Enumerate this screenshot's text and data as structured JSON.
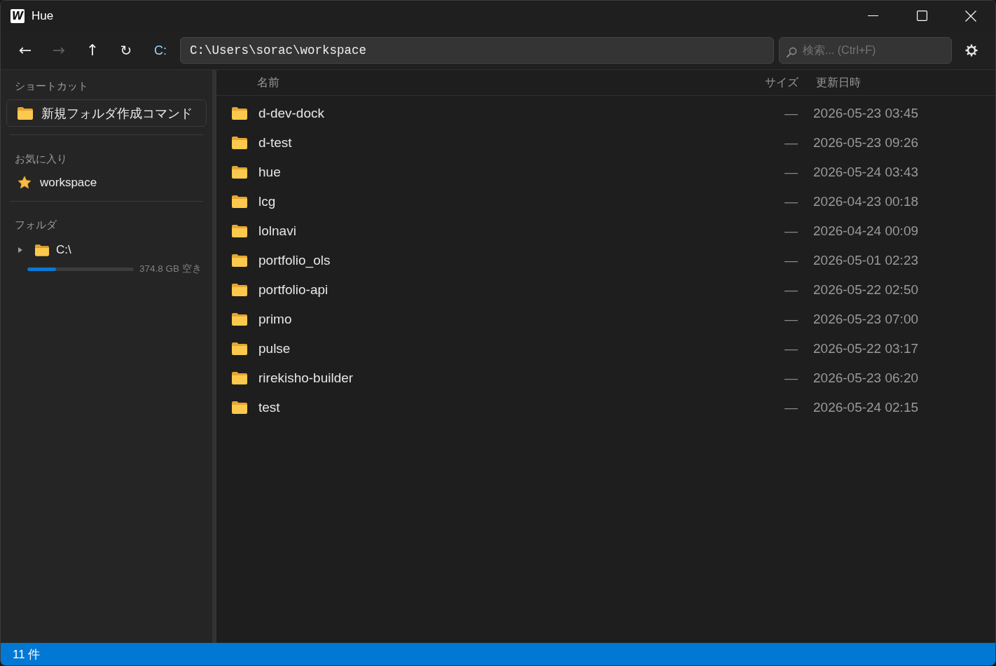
{
  "window": {
    "app_icon": "W",
    "title": "Hue"
  },
  "toolbar": {
    "nav_buttons": [
      {
        "kind": "back",
        "label": "←",
        "disabled": false
      },
      {
        "kind": "forward",
        "label": "→",
        "disabled": true
      },
      {
        "kind": "up",
        "label": "↑",
        "disabled": false
      },
      {
        "kind": "refresh",
        "label": "↻",
        "disabled": false
      },
      {
        "kind": "drive",
        "label": "C:",
        "disabled": false
      }
    ],
    "path": "C:\\Users\\sorac\\workspace",
    "search": {
      "placeholder": "検索... (Ctrl+F)"
    }
  },
  "sidebar": {
    "shortcuts": {
      "title": "ショートカット",
      "items": [
        {
          "label": "新規フォルダ作成コマンド"
        }
      ]
    },
    "favorites": {
      "title": "お気に入り",
      "items": [
        {
          "label": "workspace"
        }
      ]
    },
    "folders": {
      "title": "フォルダ",
      "tree": [
        {
          "label": "C:\\",
          "expanded": false,
          "level": 0.27,
          "free_space": "374.8 GB 空き"
        }
      ]
    }
  },
  "file_list": {
    "columns": [
      "名前",
      "サイズ",
      "更新日時"
    ],
    "rows": [
      {
        "name": "d-dev-dock",
        "size": "—",
        "modified": "2026-05-23 03:45"
      },
      {
        "name": "d-test",
        "size": "—",
        "modified": "2026-05-23 09:26"
      },
      {
        "name": "hue",
        "size": "—",
        "modified": "2026-05-24 03:43"
      },
      {
        "name": "lcg",
        "size": "—",
        "modified": "2026-04-23 00:18"
      },
      {
        "name": "lolnavi",
        "size": "—",
        "modified": "2026-04-24 00:09"
      },
      {
        "name": "portfolio_ols",
        "size": "—",
        "modified": "2026-05-01 02:23"
      },
      {
        "name": "portfolio-api",
        "size": "—",
        "modified": "2026-05-22 02:50"
      },
      {
        "name": "primo",
        "size": "—",
        "modified": "2026-05-23 07:00"
      },
      {
        "name": "pulse",
        "size": "—",
        "modified": "2026-05-22 03:17"
      },
      {
        "name": "rirekisho-builder",
        "size": "—",
        "modified": "2026-05-23 06:20"
      },
      {
        "name": "test",
        "size": "—",
        "modified": "2026-05-24 02:15"
      }
    ]
  },
  "status_bar": {
    "text": "11 件"
  }
}
